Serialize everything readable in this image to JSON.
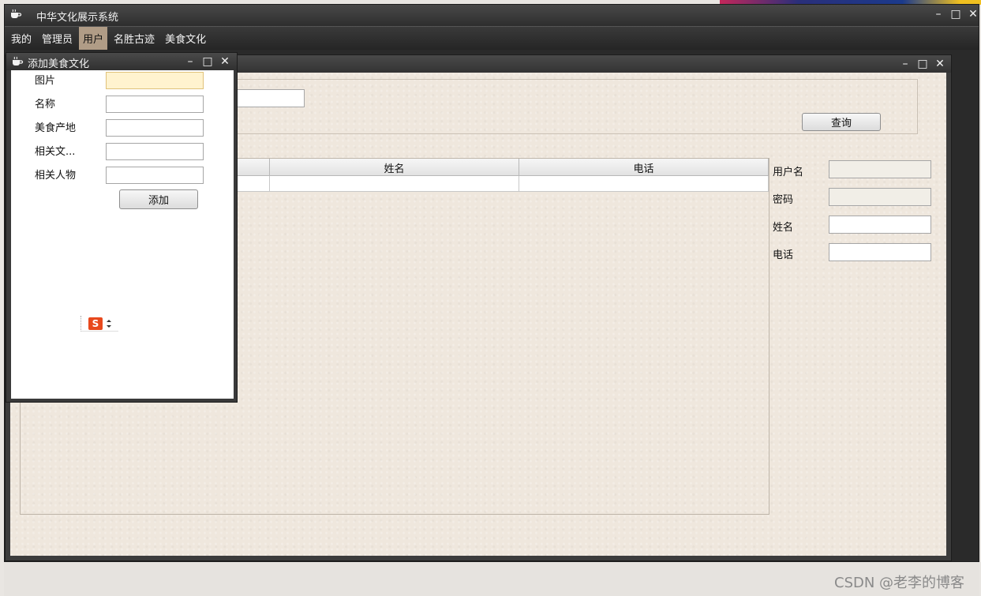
{
  "app": {
    "title": "中华文化展示系统",
    "icon": "coffee-cup-icon"
  },
  "menu": {
    "items": [
      {
        "label": "我的"
      },
      {
        "label": "管理员"
      },
      {
        "label": "用户"
      },
      {
        "label": "名胜古迹"
      },
      {
        "label": "美食文化"
      }
    ],
    "active": "用户"
  },
  "window_controls": {
    "minimize": "–",
    "maximize": "□",
    "close": "✕"
  },
  "user_window": {
    "query_button": "查询",
    "table": {
      "columns": [
        "",
        "姓名",
        "电话"
      ],
      "rows": [
        [
          "",
          "",
          ""
        ]
      ]
    },
    "detail_form": [
      {
        "label": "用户名",
        "value": "",
        "readonly": true
      },
      {
        "label": "密码",
        "value": "",
        "readonly": true
      },
      {
        "label": "姓名",
        "value": "",
        "readonly": false
      },
      {
        "label": "电话",
        "value": "",
        "readonly": false
      }
    ]
  },
  "food_window": {
    "title": "添加美食文化",
    "fields": [
      {
        "label": "图片",
        "value": ""
      },
      {
        "label": "名称",
        "value": ""
      },
      {
        "label": "美食产地",
        "value": ""
      },
      {
        "label": "相关文...",
        "value": ""
      },
      {
        "label": "相关人物",
        "value": ""
      }
    ],
    "add_button": "添加",
    "ime_label": "S"
  },
  "watermark": "CSDN @老李的博客",
  "colors": {
    "active_menu": "#b09c86",
    "focus_input": "#fff3cf",
    "body_bg": "#efe7dd",
    "ime_logo": "#e8491d"
  }
}
